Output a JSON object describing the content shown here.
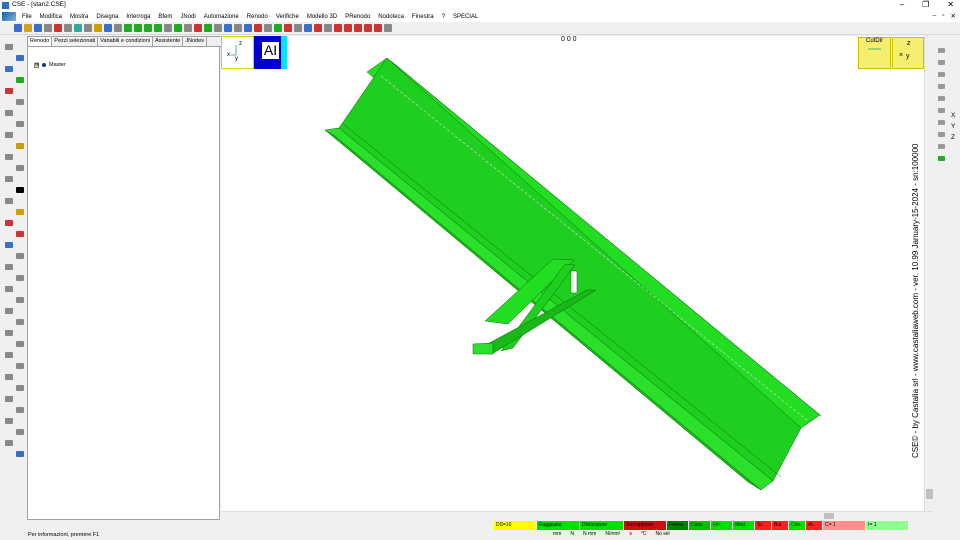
{
  "window": {
    "title": "CSE - [stan2.CSE]",
    "controls": [
      "–",
      "❐",
      "✕"
    ],
    "mdi_controls": [
      "–",
      "▫",
      "✕"
    ]
  },
  "menu": [
    "File",
    "Modifica",
    "Mostra",
    "Disegna",
    "Interroga",
    "Bfem",
    "JNodi",
    "Automazione",
    "Renodo",
    "Verifiche",
    "Modello 3D",
    "PRenodo",
    "Nodoteca",
    "Finestra",
    "?",
    "SPECIAL"
  ],
  "panel": {
    "tabs": [
      "Renodo",
      "Pezzi selezionati",
      "Variabili e condizioni",
      "Assistente",
      "JNodes"
    ],
    "tree_expander": "⊞",
    "tree_root": "Master"
  },
  "viewport": {
    "coords": "0  0  0",
    "axes": {
      "z": "z",
      "x": "x",
      "y": "y"
    },
    "ai_label": "AI",
    "cutdir_label": "CutDir",
    "zview": {
      "z": "z",
      "x": "×",
      "y": "y"
    },
    "vertical_text": "CSE© - by Castalia srl - www.castaliaweb.com - ver. 10.99 January-15-2024 - sn:100000",
    "colors": {
      "beam": "#22dd22",
      "beam_dark": "#0a9e0a",
      "beam_light": "#5cf05c",
      "edge": "#0b6b0b"
    }
  },
  "right_labels": [
    "X",
    "Y",
    "Z"
  ],
  "status": {
    "info": "Per informazioni, premere F1",
    "cells": [
      {
        "label": "DS=10",
        "color": "#ffff00"
      },
      {
        "label": "Raggiusta",
        "color": "#00e000"
      },
      {
        "label": "Dislocatore",
        "color": "#00e000"
      },
      {
        "label": "Sovrapposto",
        "color": "#cc1010"
      },
      {
        "label": "Fermo",
        "color": "#008000"
      },
      {
        "label": "Carp.",
        "color": "#00c000"
      },
      {
        "label": "Fin.",
        "color": "#00e000"
      },
      {
        "label": "Med.",
        "color": "#00e000"
      },
      {
        "label": "Sc.",
        "color": "#ff2020"
      },
      {
        "label": "Bul.",
        "color": "#ff2020"
      },
      {
        "label": "Con.",
        "color": "#00e000"
      },
      {
        "label": "At.",
        "color": "#ff2020"
      },
      {
        "label": "C= 1",
        "color": "#ff9090"
      },
      {
        "label": "I= 1",
        "color": "#90ff90"
      }
    ],
    "units": [
      "mm",
      "N",
      "N mm",
      "N/mm²",
      "s",
      "°C",
      "No sel"
    ]
  }
}
